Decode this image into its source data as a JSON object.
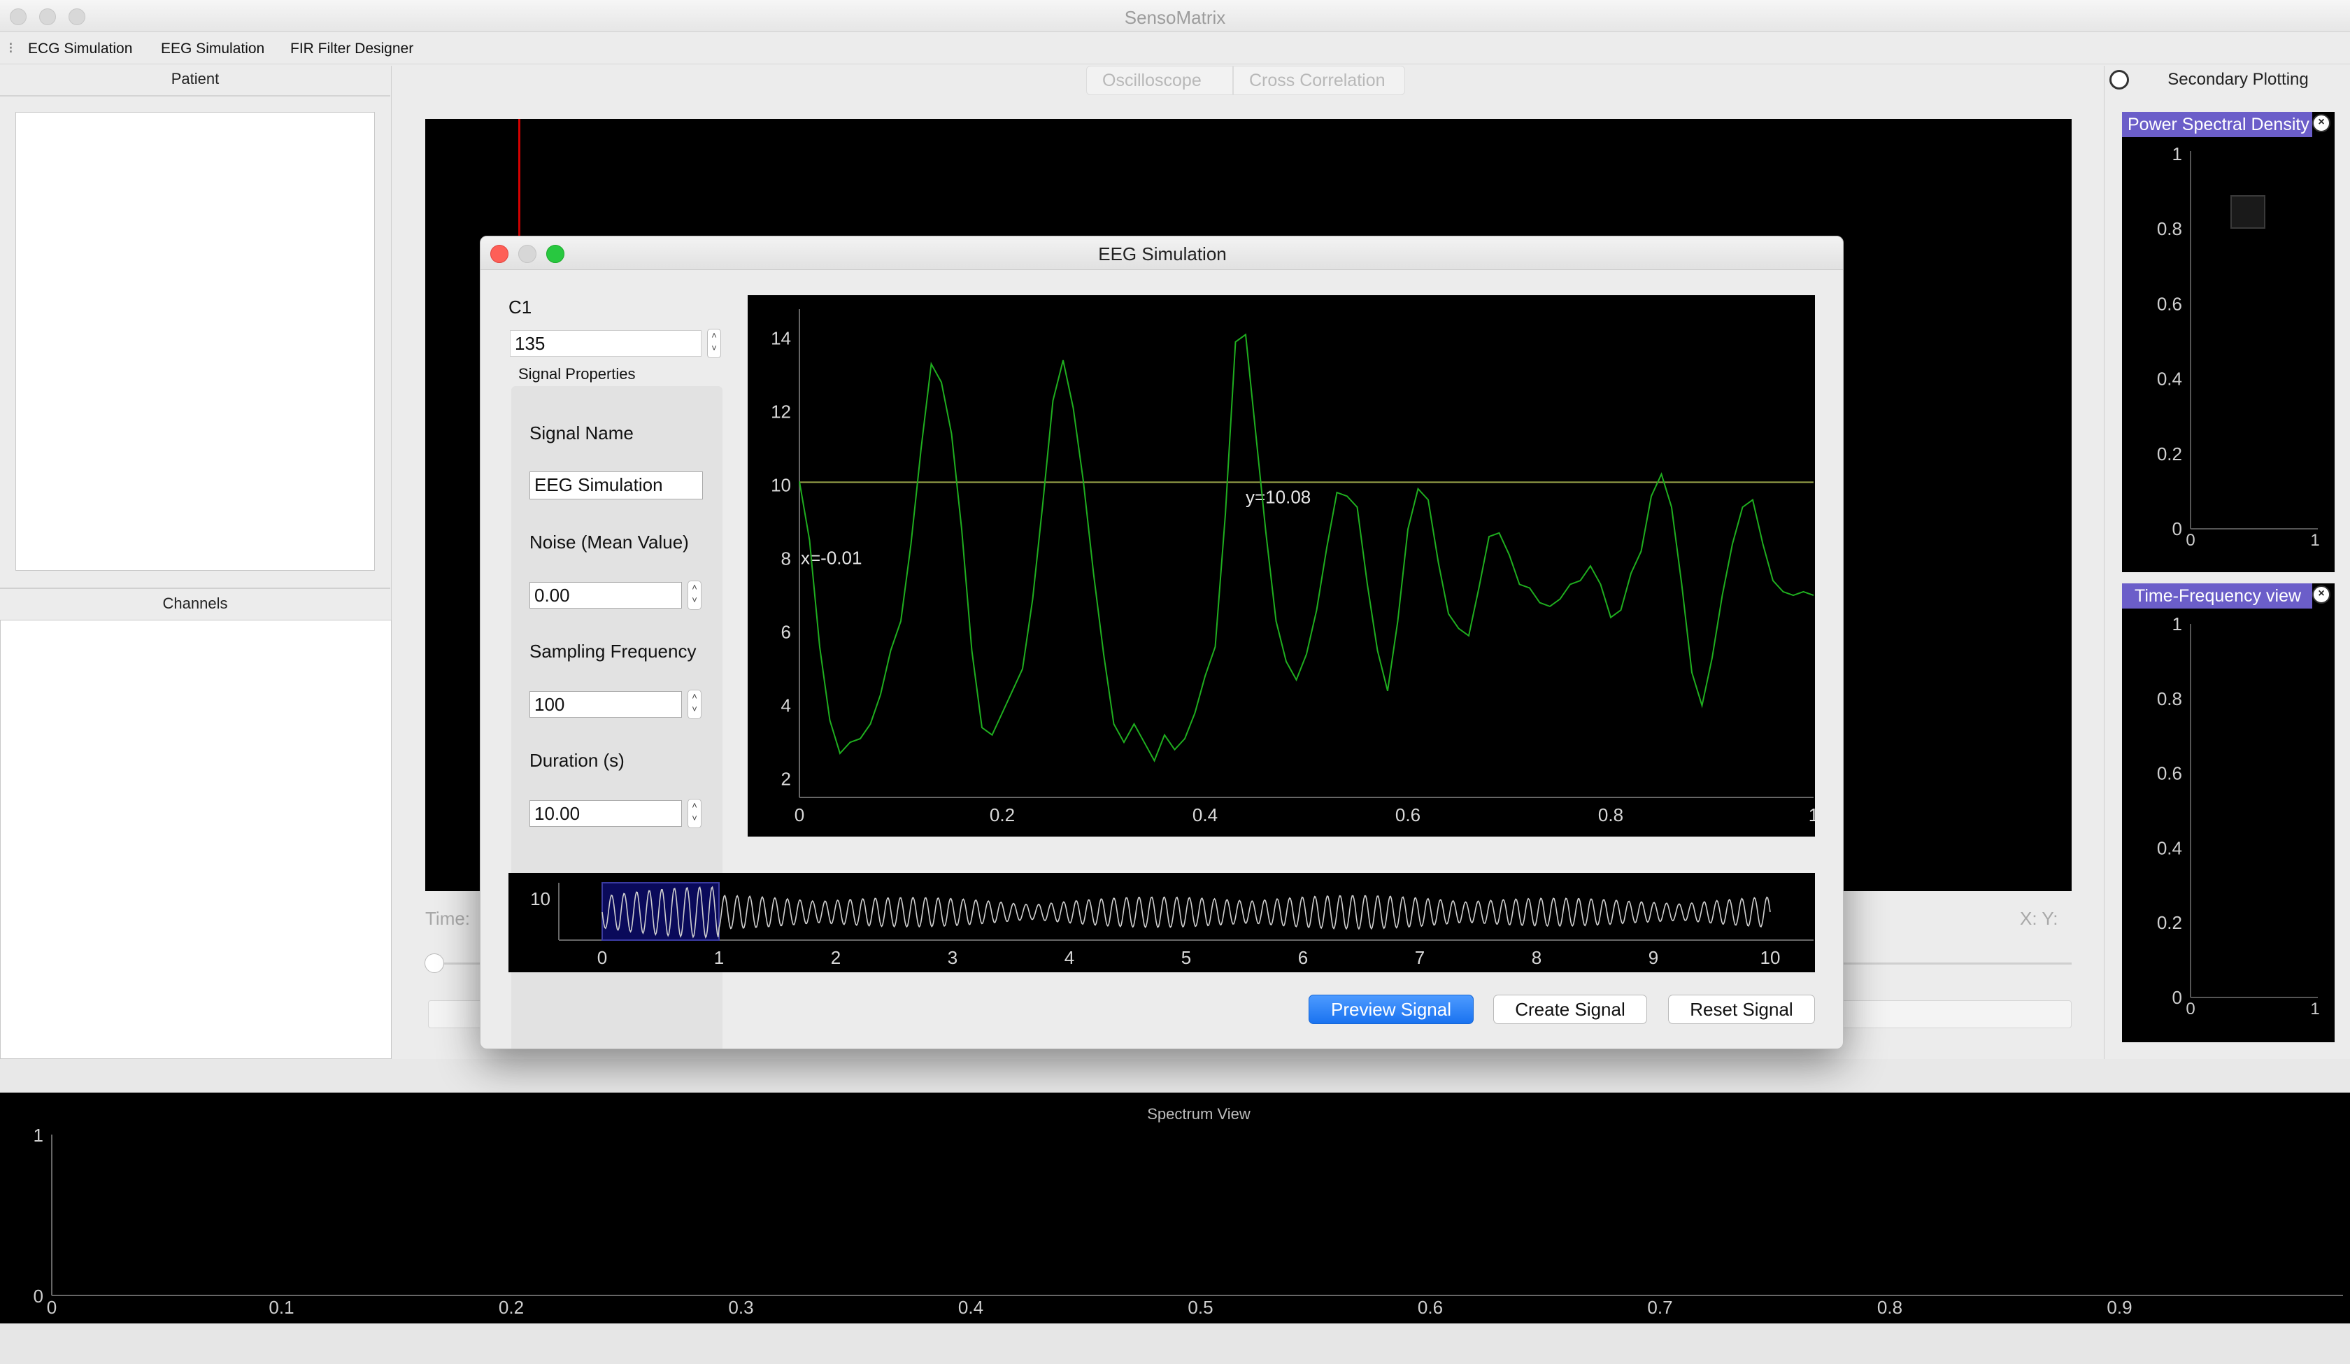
{
  "window": {
    "title": "SensoMatrix"
  },
  "menu": {
    "items": [
      "ECG Simulation",
      "EEG Simulation",
      "FIR Filter Designer"
    ]
  },
  "left": {
    "patient_header": "Patient",
    "channels_header": "Channels"
  },
  "center": {
    "tabs": [
      "Oscilloscope",
      "Cross Correlation"
    ],
    "time_label": "Time:",
    "xy_label": "X:   Y:"
  },
  "right": {
    "header": "Secondary Plotting",
    "psd": {
      "title": "Power Spectral Density",
      "yticks": [
        "1",
        "0.8",
        "0.6",
        "0.4",
        "0.2",
        "0"
      ],
      "xticks": [
        "0",
        "1"
      ]
    },
    "tf": {
      "title": "Time-Frequency view",
      "yticks": [
        "1",
        "0.8",
        "0.6",
        "0.4",
        "0.2",
        "0"
      ],
      "xticks": [
        "0",
        "1"
      ]
    }
  },
  "spectrum": {
    "title": "Spectrum View",
    "yticks": [
      "1",
      "0"
    ],
    "xticks": [
      "0",
      "0.1",
      "0.2",
      "0.3",
      "0.4",
      "0.5",
      "0.6",
      "0.7",
      "0.8",
      "0.9"
    ]
  },
  "dialog": {
    "title": "EEG Simulation",
    "channel_label": "C1",
    "channel_value": "135",
    "group_title": "Signal Properties",
    "fields": {
      "signal_name_label": "Signal Name",
      "signal_name_value": "EEG Simulation",
      "noise_label": "Noise (Mean Value)",
      "noise_value": "0.00",
      "fs_label": "Sampling Frequency",
      "fs_value": "100",
      "duration_label": "Duration (s)",
      "duration_value": "10.00"
    },
    "buttons": {
      "preview": "Preview Signal",
      "create": "Create Signal",
      "reset": "Reset Signal"
    },
    "colors": {
      "signal": "#1fae1f",
      "primary_button": "#1a73f0",
      "dock_title": "#6b5ec9",
      "cursor": "#d40000"
    }
  },
  "chart_data": [
    {
      "type": "line",
      "name": "main-preview",
      "xlim": [
        0,
        1
      ],
      "ylim": [
        1.5,
        14.6
      ],
      "xticks": [
        "0",
        "0.2",
        "0.4",
        "0.6",
        "0.8",
        "1"
      ],
      "yticks": [
        "2",
        "4",
        "6",
        "8",
        "10",
        "12",
        "14"
      ],
      "crosshair": {
        "x": -0.01,
        "y": 10.08,
        "x_label": "x=-0.01",
        "y_label": "y=10.08"
      },
      "x": [
        0,
        0.01,
        0.02,
        0.03,
        0.04,
        0.05,
        0.06,
        0.07,
        0.08,
        0.09,
        0.1,
        0.11,
        0.12,
        0.13,
        0.14,
        0.15,
        0.16,
        0.17,
        0.18,
        0.19,
        0.2,
        0.21,
        0.22,
        0.23,
        0.24,
        0.25,
        0.26,
        0.27,
        0.28,
        0.29,
        0.3,
        0.31,
        0.32,
        0.33,
        0.34,
        0.35,
        0.36,
        0.37,
        0.38,
        0.39,
        0.4,
        0.41,
        0.42,
        0.43,
        0.44,
        0.45,
        0.46,
        0.47,
        0.48,
        0.49,
        0.5,
        0.51,
        0.52,
        0.53,
        0.54,
        0.55,
        0.56,
        0.57,
        0.58,
        0.59,
        0.6,
        0.61,
        0.62,
        0.63,
        0.64,
        0.65,
        0.66,
        0.67,
        0.68,
        0.69,
        0.7,
        0.71,
        0.72,
        0.73,
        0.74,
        0.75,
        0.76,
        0.77,
        0.78,
        0.79,
        0.8,
        0.81,
        0.82,
        0.83,
        0.84,
        0.85,
        0.86,
        0.87,
        0.88,
        0.89,
        0.9,
        0.91,
        0.92,
        0.93,
        0.94,
        0.95,
        0.96,
        0.97,
        0.98,
        0.99,
        1.0
      ],
      "y": [
        10.1,
        8.5,
        5.6,
        3.6,
        2.7,
        3.0,
        3.1,
        3.5,
        4.3,
        5.5,
        6.3,
        8.4,
        11.0,
        13.3,
        12.8,
        11.4,
        8.8,
        5.5,
        3.4,
        3.2,
        3.8,
        4.4,
        5.0,
        6.9,
        9.5,
        12.3,
        13.4,
        12.1,
        10.1,
        7.6,
        5.4,
        3.5,
        3.0,
        3.5,
        3.0,
        2.5,
        3.2,
        2.8,
        3.1,
        3.8,
        4.8,
        5.6,
        9.2,
        13.9,
        14.1,
        11.4,
        8.7,
        6.3,
        5.2,
        4.7,
        5.4,
        6.6,
        8.3,
        9.8,
        9.7,
        9.4,
        7.3,
        5.5,
        4.4,
        6.3,
        8.8,
        9.9,
        9.6,
        7.9,
        6.5,
        6.1,
        5.9,
        7.2,
        8.6,
        8.7,
        8.1,
        7.3,
        7.2,
        6.8,
        6.7,
        6.9,
        7.3,
        7.4,
        7.8,
        7.3,
        6.4,
        6.6,
        7.6,
        8.2,
        9.7,
        10.3,
        9.4,
        7.3,
        4.9,
        4.0,
        5.3,
        7.0,
        8.4,
        9.4,
        9.6,
        8.4,
        7.4,
        7.1,
        7.0,
        7.1,
        7.0
      ]
    },
    {
      "type": "line",
      "name": "overview",
      "xlim": [
        0,
        10
      ],
      "xticks": [
        "0",
        "1",
        "2",
        "3",
        "4",
        "5",
        "6",
        "7",
        "8",
        "9",
        "10"
      ],
      "yticks": [
        "10"
      ],
      "selection": [
        0,
        1
      ]
    }
  ]
}
